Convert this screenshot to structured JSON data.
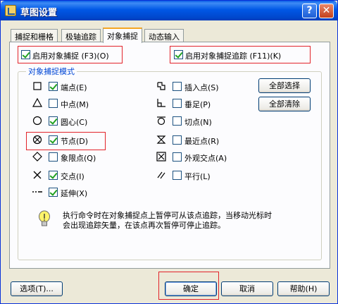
{
  "window": {
    "title": "草图设置"
  },
  "titlebar": {
    "help": "?",
    "close": "✕"
  },
  "tabs": [
    "捕捉和栅格",
    "极轴追踪",
    "对象捕捉",
    "动态输入"
  ],
  "top": {
    "snap_on": "启用对象捕捉 (F3)(O)",
    "tracking_on": "启用对象捕捉追踪 (F11)(K)"
  },
  "group_title": "对象捕捉模式",
  "modes_left": [
    {
      "label": "端点(E)",
      "checked": true
    },
    {
      "label": "中点(M)",
      "checked": false
    },
    {
      "label": "圆心(C)",
      "checked": true
    },
    {
      "label": "节点(D)",
      "checked": true
    },
    {
      "label": "象限点(Q)",
      "checked": false
    },
    {
      "label": "交点(I)",
      "checked": true
    },
    {
      "label": "延伸(X)",
      "checked": true
    }
  ],
  "modes_right": [
    {
      "label": "插入点(S)",
      "checked": false
    },
    {
      "label": "垂足(P)",
      "checked": false
    },
    {
      "label": "切点(N)",
      "checked": false
    },
    {
      "label": "最近点(R)",
      "checked": false
    },
    {
      "label": "外观交点(A)",
      "checked": false
    },
    {
      "label": "平行(L)",
      "checked": false
    }
  ],
  "buttons": {
    "select_all": "全部选择",
    "clear_all": "全部清除",
    "options": "选项(T)...",
    "ok": "确定",
    "cancel": "取消",
    "help": "帮助(H)"
  },
  "info": {
    "line1": "执行命令时在对象捕捉点上暂停可从该点追踪，当移动光标时",
    "line2": "会出现追踪矢量，在该点再次暂停可停止追踪。"
  },
  "colors": {
    "accent": "#e2232a",
    "group_title": "#0046d5",
    "titlebar": "#0058e6"
  }
}
